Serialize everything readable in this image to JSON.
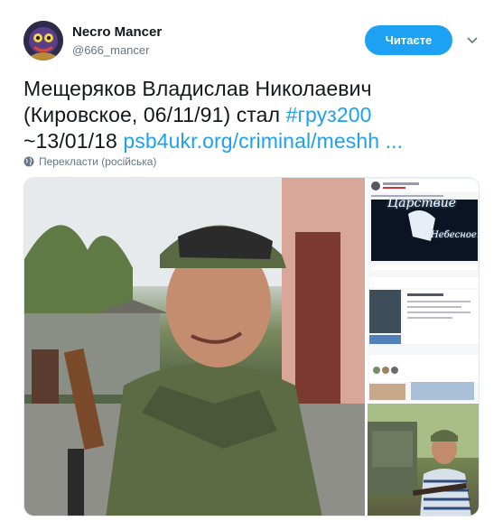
{
  "user": {
    "display_name": "Necro Mancer",
    "handle": "@666_mancer",
    "avatar_icon": "avatar-icon"
  },
  "follow_button": {
    "label": "Читаєте"
  },
  "tweet": {
    "line1": "Мещеряков Владислав Николаевич",
    "line2_prefix": "(Кировское, 06/11/91) стал ",
    "hashtag": "#груз200",
    "line3_prefix": "~13/01/18 ",
    "link": "psb4ukr.org/criminal/meshh ..."
  },
  "translate": {
    "label": "Перекласти (російська)",
    "icon": "globe-icon"
  },
  "media": {
    "collage_text_1": "Царствие",
    "collage_text_2": "Небесное..."
  },
  "colors": {
    "accent": "#1da1f2",
    "text": "#14171a",
    "muted": "#657786"
  }
}
